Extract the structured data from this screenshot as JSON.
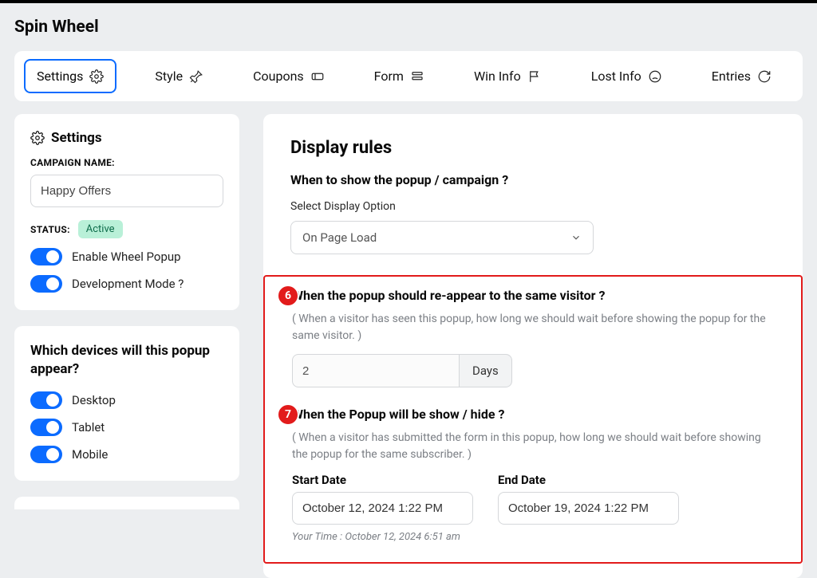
{
  "page_title": "Spin Wheel",
  "tabs": {
    "settings": "Settings",
    "style": "Style",
    "coupons": "Coupons",
    "form": "Form",
    "win_info": "Win Info",
    "lost_info": "Lost Info",
    "entries": "Entries"
  },
  "sidebar": {
    "settings_title": "Settings",
    "campaign_name_label": "CAMPAIGN NAME:",
    "campaign_name_value": "Happy Offers",
    "status_label": "STATUS:",
    "status_value": "Active",
    "toggle_enable_wheel": "Enable Wheel Popup",
    "toggle_dev_mode": "Development Mode ?",
    "devices_title": "Which devices will this popup appear?",
    "device_desktop": "Desktop",
    "device_tablet": "Tablet",
    "device_mobile": "Mobile"
  },
  "main": {
    "title": "Display rules",
    "q1": "When to show the popup / campaign ?",
    "select_label": "Select Display Option",
    "select_value": "On Page Load",
    "badge6": "6",
    "q2": "When the popup should re-appear to the same visitor ?",
    "q2_desc": "( When a visitor has seen this popup, how long we should wait before showing the popup for the same visitor. )",
    "reappear_value": "2",
    "reappear_unit": "Days",
    "badge7": "7",
    "q3": "When the Popup will be show / hide ?",
    "q3_desc": "( When a visitor has submitted the form in this popup, how long we should wait before showing the popup for the same subscriber. )",
    "start_date_label": "Start Date",
    "start_date_value": "October 12, 2024 1:22 PM",
    "end_date_label": "End Date",
    "end_date_value": "October 19, 2024 1:22 PM",
    "your_time": "Your Time : October 12, 2024 6:51 am"
  }
}
